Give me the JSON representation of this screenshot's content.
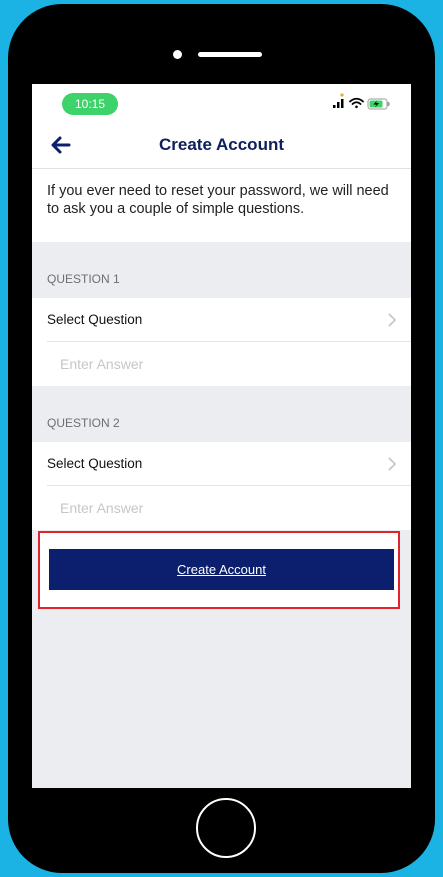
{
  "status_bar": {
    "time": "10:15",
    "icons": [
      "cellular-signal-icon",
      "wifi-icon",
      "battery-charging-icon"
    ]
  },
  "nav": {
    "back_icon": "back-arrow-icon",
    "title": "Create Account"
  },
  "intro_text": "If you ever need to reset your password, we will need to ask you a couple of simple questions.",
  "questions": [
    {
      "header": "QUESTION 1",
      "select_label": "Select Question",
      "answer_placeholder": "Enter Answer",
      "answer_value": ""
    },
    {
      "header": "QUESTION 2",
      "select_label": "Select Question",
      "answer_placeholder": "Enter Answer",
      "answer_value": ""
    }
  ],
  "create_button_label": "Create Account",
  "colors": {
    "background": "#1ab3e3",
    "primary_button": "#0b1f6e",
    "title_text": "#0d1f5c",
    "time_pill": "#3dd26a",
    "highlight_border": "#e3232b"
  }
}
